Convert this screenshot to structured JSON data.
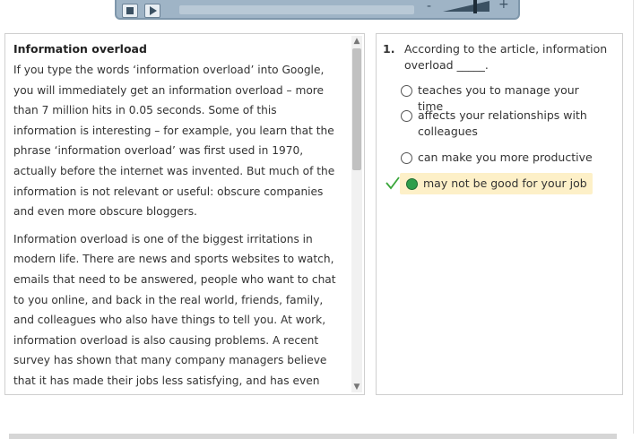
{
  "player": {
    "volume_minus": "-",
    "volume_plus": "+",
    "stop_icon": "stop-icon",
    "play_icon": "play-icon"
  },
  "article": {
    "title": "Information overload",
    "paragraphs": [
      "If you type the words ‘information overload’ into Google, you will immediately get an information overload – more than 7 million hits in 0.05 seconds. Some of this information is interesting – for example, you learn that the phrase ‘information overload’ was first used in 1970, actually before the internet was invented. But much of the information is not relevant or useful: obscure companies and even more obscure bloggers.",
      "Information overload is one of the biggest irritations in modern life. There are news and sports websites to watch, emails that need to be answered, people who want to chat to you online, and back in the real world, friends, family, and colleagues who also have things to tell you. At work, information overload is also causing problems. A recent survey has shown that many company managers believe that it has made their jobs less satisfying, and has even affected"
    ]
  },
  "question": {
    "number": "1.",
    "text": "According to the article, information overload _____.",
    "options": [
      {
        "label": "teaches you to manage your time",
        "selected": false
      },
      {
        "label": "affects your relationships with colleagues",
        "selected": false
      },
      {
        "label": "can make you more productive",
        "selected": false
      },
      {
        "label": "may not be good for your job",
        "selected": true
      }
    ],
    "correct_mark": "checkmark-icon"
  },
  "colors": {
    "selected_bg": "#fdf0c8",
    "selected_radio": "#2e9e4b",
    "check_green": "#3aa63a",
    "player_bg": "#9fb4c6"
  }
}
